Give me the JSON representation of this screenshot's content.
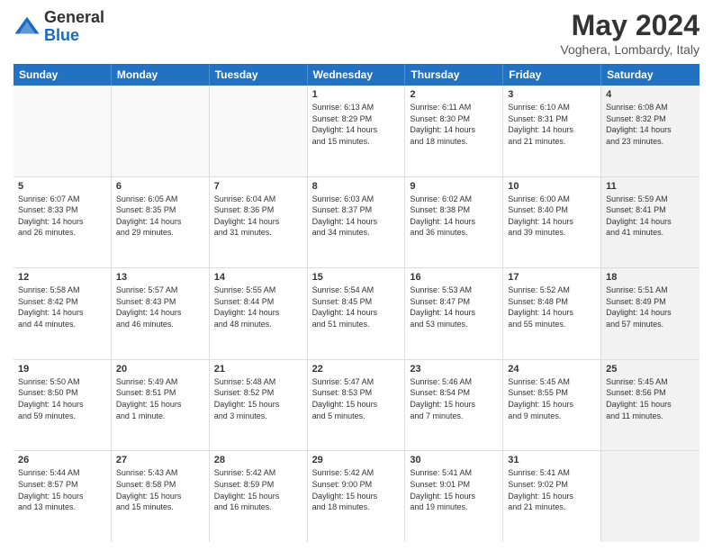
{
  "header": {
    "logo_line1": "General",
    "logo_line2": "Blue",
    "month_title": "May 2024",
    "location": "Voghera, Lombardy, Italy"
  },
  "days_of_week": [
    "Sunday",
    "Monday",
    "Tuesday",
    "Wednesday",
    "Thursday",
    "Friday",
    "Saturday"
  ],
  "weeks": [
    [
      {
        "day": "",
        "info": "",
        "empty": true
      },
      {
        "day": "",
        "info": "",
        "empty": true
      },
      {
        "day": "",
        "info": "",
        "empty": true
      },
      {
        "day": "1",
        "info": "Sunrise: 6:13 AM\nSunset: 8:29 PM\nDaylight: 14 hours\nand 15 minutes.",
        "empty": false
      },
      {
        "day": "2",
        "info": "Sunrise: 6:11 AM\nSunset: 8:30 PM\nDaylight: 14 hours\nand 18 minutes.",
        "empty": false
      },
      {
        "day": "3",
        "info": "Sunrise: 6:10 AM\nSunset: 8:31 PM\nDaylight: 14 hours\nand 21 minutes.",
        "empty": false
      },
      {
        "day": "4",
        "info": "Sunrise: 6:08 AM\nSunset: 8:32 PM\nDaylight: 14 hours\nand 23 minutes.",
        "empty": false,
        "shaded": true
      }
    ],
    [
      {
        "day": "5",
        "info": "Sunrise: 6:07 AM\nSunset: 8:33 PM\nDaylight: 14 hours\nand 26 minutes.",
        "empty": false
      },
      {
        "day": "6",
        "info": "Sunrise: 6:05 AM\nSunset: 8:35 PM\nDaylight: 14 hours\nand 29 minutes.",
        "empty": false
      },
      {
        "day": "7",
        "info": "Sunrise: 6:04 AM\nSunset: 8:36 PM\nDaylight: 14 hours\nand 31 minutes.",
        "empty": false
      },
      {
        "day": "8",
        "info": "Sunrise: 6:03 AM\nSunset: 8:37 PM\nDaylight: 14 hours\nand 34 minutes.",
        "empty": false
      },
      {
        "day": "9",
        "info": "Sunrise: 6:02 AM\nSunset: 8:38 PM\nDaylight: 14 hours\nand 36 minutes.",
        "empty": false
      },
      {
        "day": "10",
        "info": "Sunrise: 6:00 AM\nSunset: 8:40 PM\nDaylight: 14 hours\nand 39 minutes.",
        "empty": false
      },
      {
        "day": "11",
        "info": "Sunrise: 5:59 AM\nSunset: 8:41 PM\nDaylight: 14 hours\nand 41 minutes.",
        "empty": false,
        "shaded": true
      }
    ],
    [
      {
        "day": "12",
        "info": "Sunrise: 5:58 AM\nSunset: 8:42 PM\nDaylight: 14 hours\nand 44 minutes.",
        "empty": false
      },
      {
        "day": "13",
        "info": "Sunrise: 5:57 AM\nSunset: 8:43 PM\nDaylight: 14 hours\nand 46 minutes.",
        "empty": false
      },
      {
        "day": "14",
        "info": "Sunrise: 5:55 AM\nSunset: 8:44 PM\nDaylight: 14 hours\nand 48 minutes.",
        "empty": false
      },
      {
        "day": "15",
        "info": "Sunrise: 5:54 AM\nSunset: 8:45 PM\nDaylight: 14 hours\nand 51 minutes.",
        "empty": false
      },
      {
        "day": "16",
        "info": "Sunrise: 5:53 AM\nSunset: 8:47 PM\nDaylight: 14 hours\nand 53 minutes.",
        "empty": false
      },
      {
        "day": "17",
        "info": "Sunrise: 5:52 AM\nSunset: 8:48 PM\nDaylight: 14 hours\nand 55 minutes.",
        "empty": false
      },
      {
        "day": "18",
        "info": "Sunrise: 5:51 AM\nSunset: 8:49 PM\nDaylight: 14 hours\nand 57 minutes.",
        "empty": false,
        "shaded": true
      }
    ],
    [
      {
        "day": "19",
        "info": "Sunrise: 5:50 AM\nSunset: 8:50 PM\nDaylight: 14 hours\nand 59 minutes.",
        "empty": false
      },
      {
        "day": "20",
        "info": "Sunrise: 5:49 AM\nSunset: 8:51 PM\nDaylight: 15 hours\nand 1 minute.",
        "empty": false
      },
      {
        "day": "21",
        "info": "Sunrise: 5:48 AM\nSunset: 8:52 PM\nDaylight: 15 hours\nand 3 minutes.",
        "empty": false
      },
      {
        "day": "22",
        "info": "Sunrise: 5:47 AM\nSunset: 8:53 PM\nDaylight: 15 hours\nand 5 minutes.",
        "empty": false
      },
      {
        "day": "23",
        "info": "Sunrise: 5:46 AM\nSunset: 8:54 PM\nDaylight: 15 hours\nand 7 minutes.",
        "empty": false
      },
      {
        "day": "24",
        "info": "Sunrise: 5:45 AM\nSunset: 8:55 PM\nDaylight: 15 hours\nand 9 minutes.",
        "empty": false
      },
      {
        "day": "25",
        "info": "Sunrise: 5:45 AM\nSunset: 8:56 PM\nDaylight: 15 hours\nand 11 minutes.",
        "empty": false,
        "shaded": true
      }
    ],
    [
      {
        "day": "26",
        "info": "Sunrise: 5:44 AM\nSunset: 8:57 PM\nDaylight: 15 hours\nand 13 minutes.",
        "empty": false
      },
      {
        "day": "27",
        "info": "Sunrise: 5:43 AM\nSunset: 8:58 PM\nDaylight: 15 hours\nand 15 minutes.",
        "empty": false
      },
      {
        "day": "28",
        "info": "Sunrise: 5:42 AM\nSunset: 8:59 PM\nDaylight: 15 hours\nand 16 minutes.",
        "empty": false
      },
      {
        "day": "29",
        "info": "Sunrise: 5:42 AM\nSunset: 9:00 PM\nDaylight: 15 hours\nand 18 minutes.",
        "empty": false
      },
      {
        "day": "30",
        "info": "Sunrise: 5:41 AM\nSunset: 9:01 PM\nDaylight: 15 hours\nand 19 minutes.",
        "empty": false
      },
      {
        "day": "31",
        "info": "Sunrise: 5:41 AM\nSunset: 9:02 PM\nDaylight: 15 hours\nand 21 minutes.",
        "empty": false
      },
      {
        "day": "",
        "info": "",
        "empty": true,
        "shaded": true
      }
    ]
  ]
}
